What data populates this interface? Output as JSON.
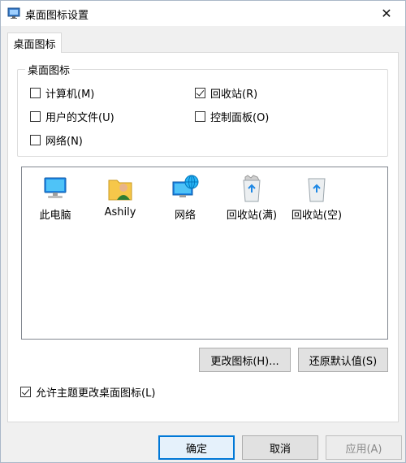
{
  "window": {
    "title": "桌面图标设置",
    "close_glyph": "✕"
  },
  "tabs": [
    {
      "label": "桌面图标",
      "active": true
    }
  ],
  "desktop_icons_group": {
    "title": "桌面图标",
    "checkboxes": [
      {
        "label": "计算机(M)",
        "checked": false
      },
      {
        "label": "回收站(R)",
        "checked": true
      },
      {
        "label": "用户的文件(U)",
        "checked": false
      },
      {
        "label": "控制面板(O)",
        "checked": false
      },
      {
        "label": "网络(N)",
        "checked": false
      }
    ]
  },
  "icon_list": {
    "items": [
      {
        "label": "此电脑",
        "icon": "computer-icon"
      },
      {
        "label": "Ashily",
        "icon": "user-folder-icon"
      },
      {
        "label": "网络",
        "icon": "network-icon"
      },
      {
        "label": "回收站(满)",
        "icon": "recycle-bin-full-icon"
      },
      {
        "label": "回收站(空)",
        "icon": "recycle-bin-empty-icon"
      }
    ]
  },
  "buttons": {
    "change_icon": "更改图标(H)...",
    "restore_default": "还原默认值(S)",
    "ok": "确定",
    "cancel": "取消",
    "apply": "应用(A)"
  },
  "allow_themes": {
    "label": "允许主题更改桌面图标(L)",
    "checked": true
  },
  "colors": {
    "accent": "#0078d7",
    "panel_bg": "#ffffff",
    "window_bg": "#f0f0f0"
  }
}
